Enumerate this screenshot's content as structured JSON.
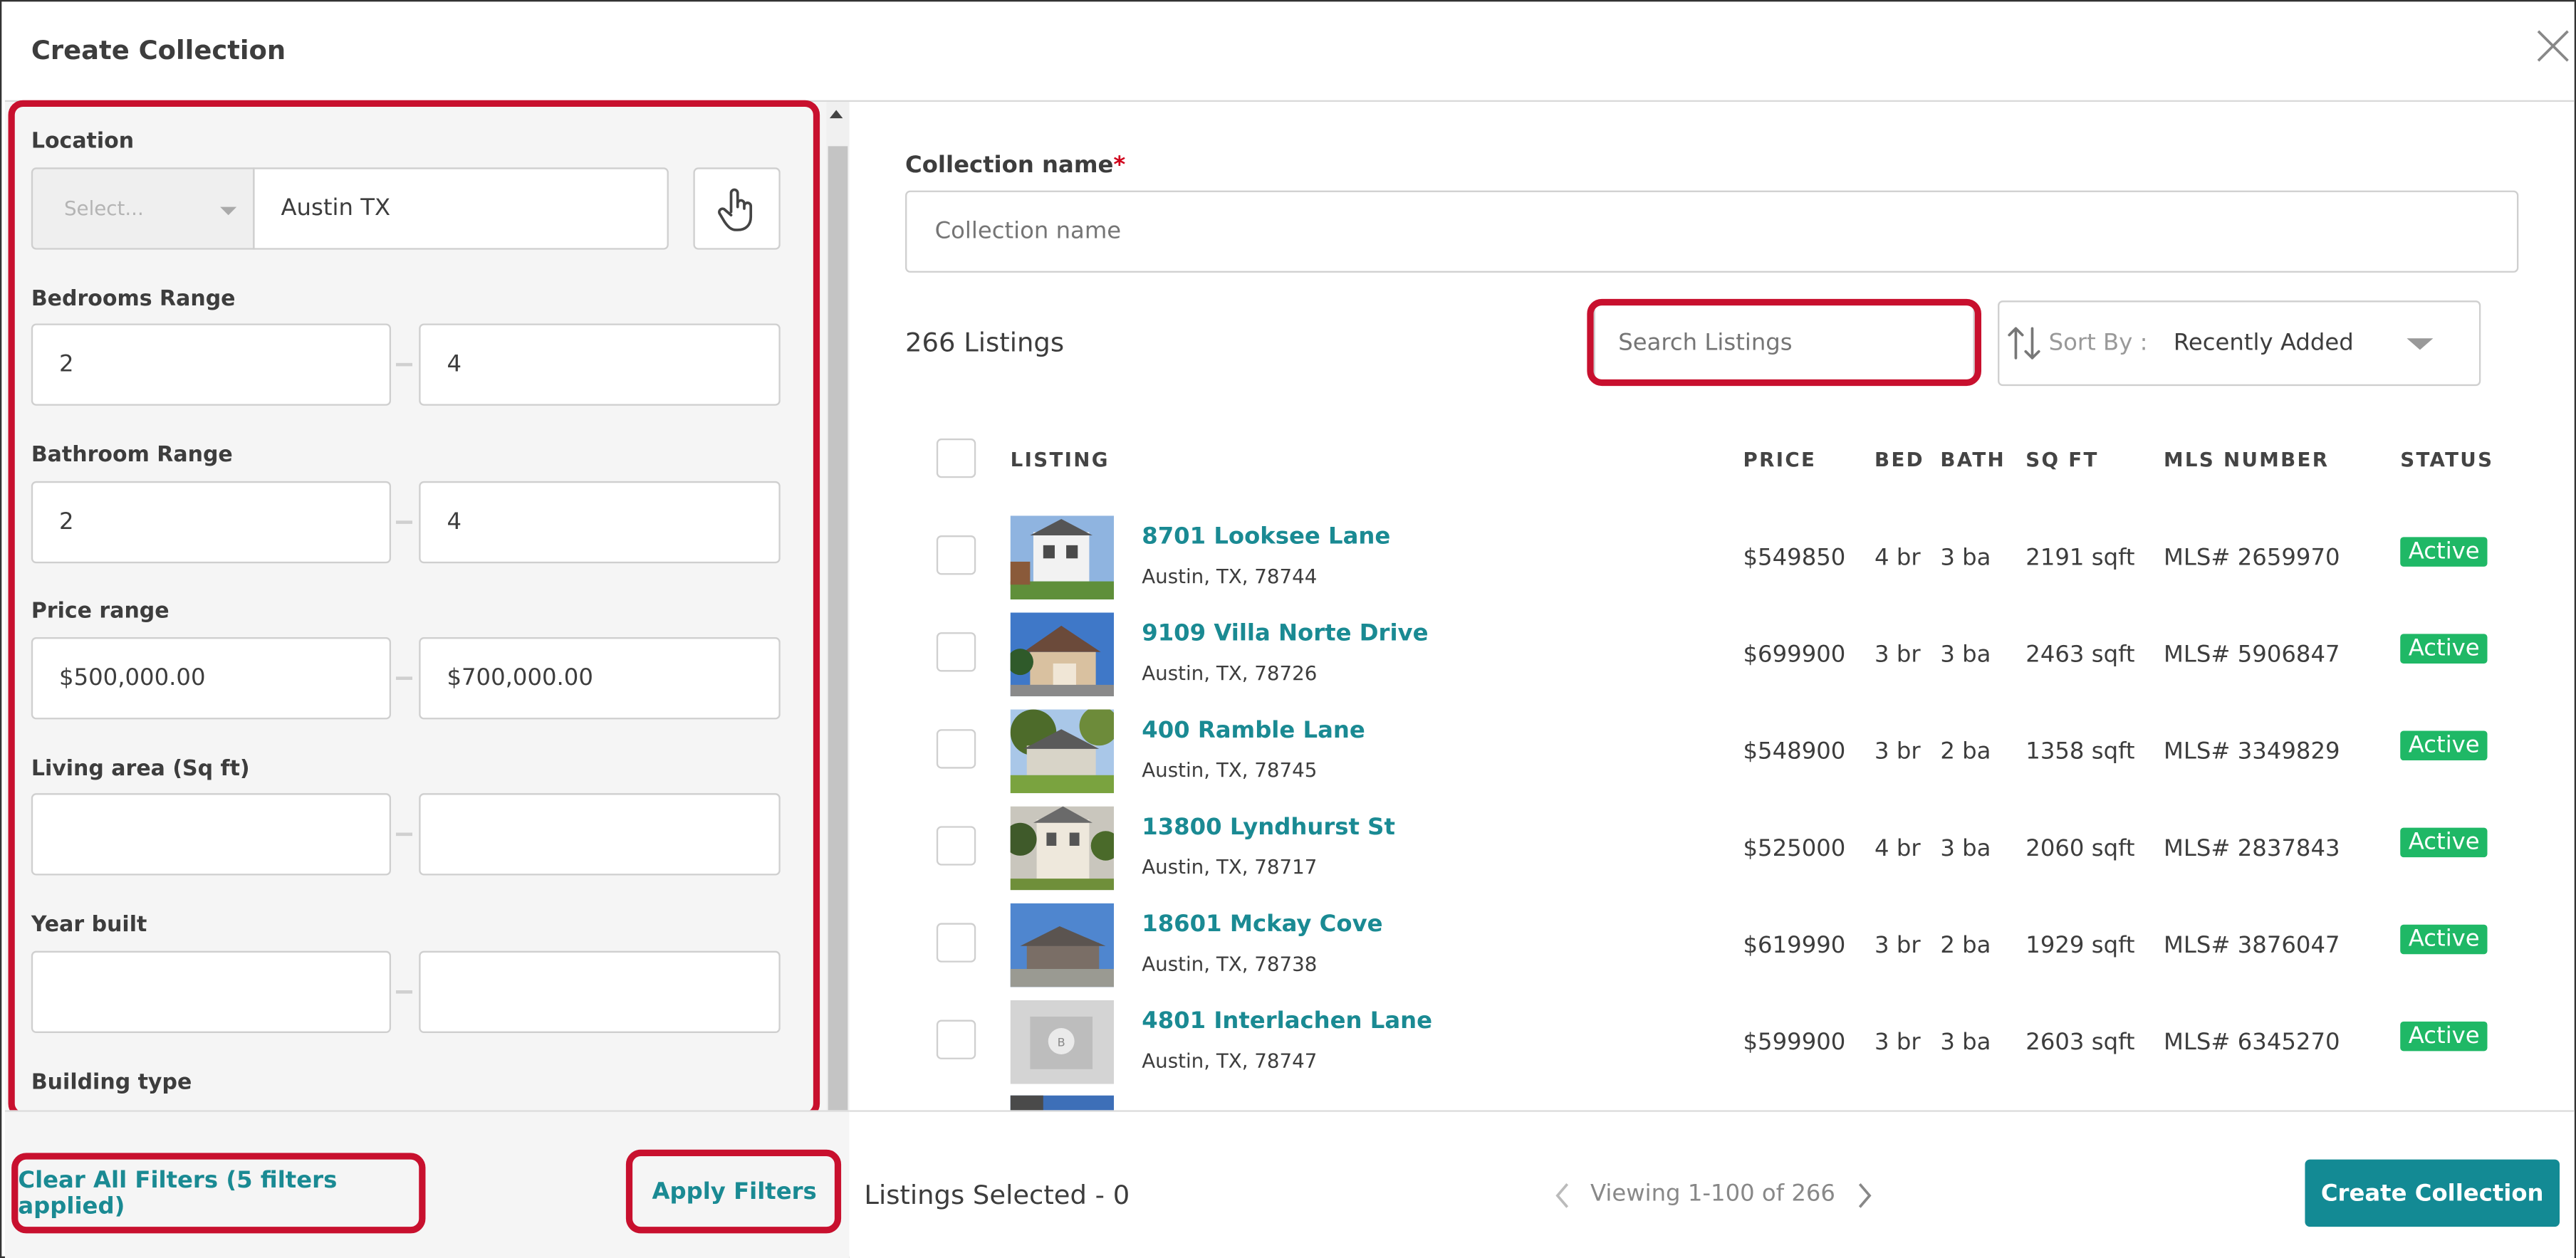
{
  "dialog": {
    "title": "Create Collection"
  },
  "filters": {
    "location": {
      "label": "Location",
      "select_placeholder": "Select...",
      "value": "Austin TX"
    },
    "bedrooms": {
      "label": "Bedrooms Range",
      "min": "2",
      "max": "4"
    },
    "bathrooms": {
      "label": "Bathroom Range",
      "min": "2",
      "max": "4"
    },
    "price": {
      "label": "Price range",
      "min": "$500,000.00",
      "max": "$700,000.00"
    },
    "living_area": {
      "label": "Living area (Sq ft)",
      "min": "",
      "max": ""
    },
    "year_built": {
      "label": "Year built",
      "min": "",
      "max": ""
    },
    "building_type": {
      "label": "Building type"
    }
  },
  "collection": {
    "name_label": "Collection name",
    "required_mark": "*",
    "name_placeholder": "Collection name"
  },
  "listings": {
    "count_label": "266 Listings",
    "search_placeholder": "Search Listings",
    "sort_label": "Sort By :",
    "sort_value": "Recently Added",
    "columns": [
      "LISTING",
      "PRICE",
      "BED",
      "BATH",
      "SQ FT",
      "MLS NUMBER",
      "STATUS"
    ],
    "rows": [
      {
        "street": "8701 Looksee Lane",
        "city": "Austin, TX, 78744",
        "price": "$549850",
        "bed": "4 br",
        "bath": "3 ba",
        "sqft": "2191 sqft",
        "mls": "MLS# 2659970",
        "status": "Active"
      },
      {
        "street": "9109 Villa Norte Drive",
        "city": "Austin, TX, 78726",
        "price": "$699900",
        "bed": "3 br",
        "bath": "3 ba",
        "sqft": "2463 sqft",
        "mls": "MLS# 5906847",
        "status": "Active"
      },
      {
        "street": "400 Ramble Lane",
        "city": "Austin, TX, 78745",
        "price": "$548900",
        "bed": "3 br",
        "bath": "2 ba",
        "sqft": "1358 sqft",
        "mls": "MLS# 3349829",
        "status": "Active"
      },
      {
        "street": "13800 Lyndhurst St",
        "city": "Austin, TX, 78717",
        "price": "$525000",
        "bed": "4 br",
        "bath": "3 ba",
        "sqft": "2060 sqft",
        "mls": "MLS# 2837843",
        "status": "Active"
      },
      {
        "street": "18601 Mckay Cove",
        "city": "Austin, TX, 78738",
        "price": "$619990",
        "bed": "3 br",
        "bath": "2 ba",
        "sqft": "1929 sqft",
        "mls": "MLS# 3876047",
        "status": "Active"
      },
      {
        "street": "4801 Interlachen Lane",
        "city": "Austin, TX, 78747",
        "price": "$599900",
        "bed": "3 br",
        "bath": "3 ba",
        "sqft": "2603 sqft",
        "mls": "MLS# 6345270",
        "status": "Active"
      }
    ]
  },
  "footer": {
    "clear_filters": "Clear All Filters (5 filters applied)",
    "apply_filters": "Apply Filters",
    "selected": "Listings Selected - 0",
    "pagination": "Viewing 1-100 of 266",
    "create_button": "Create Collection"
  },
  "colors": {
    "accent": "#138a94",
    "link": "#1a8a93",
    "status_active": "#1fb866",
    "highlight": "#c8102e"
  }
}
